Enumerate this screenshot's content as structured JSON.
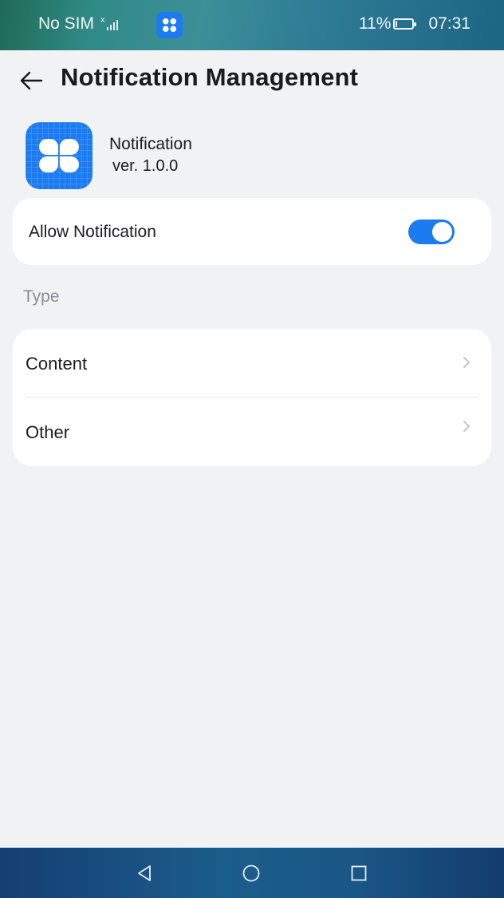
{
  "status_bar": {
    "carrier": "No SIM",
    "battery": "11%",
    "battery_level": 0.11,
    "time": "07:31"
  },
  "header": {
    "title": "Notification Management",
    "back_icon": "arrow-left-icon"
  },
  "app_info": {
    "name": "Notification",
    "version": "ver. 1.0.0",
    "icon": "four-petal-app-icon"
  },
  "allow_notification": {
    "label": "Allow Notification",
    "enabled": true
  },
  "type_section": {
    "label": "Type",
    "items": [
      {
        "label": "Content"
      },
      {
        "label": "Other"
      }
    ]
  },
  "nav_bar": {
    "back_icon": "triangle-back-icon",
    "home_icon": "circle-home-icon",
    "recents_icon": "square-recents-icon"
  },
  "colors": {
    "accent": "#1c7bf0",
    "background": "#f1f2f4",
    "card": "#ffffff",
    "secondary_text": "#8a8d93"
  }
}
